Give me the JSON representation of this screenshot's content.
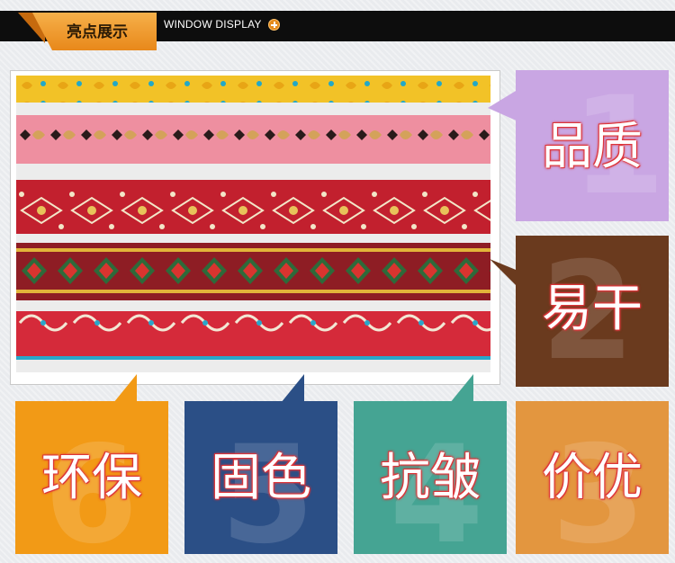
{
  "header": {
    "title_cn": "亮点展示",
    "title_en": "WINDOW DISPLAY"
  },
  "colors": {
    "header_bar": "#0d0d0d",
    "header_tag": "#f0a33a",
    "panel_quality": "#c9a6e3",
    "panel_quickdry": "#6a3a1e",
    "panel_eco": "#f29a16",
    "panel_colorfast": "#2b4f86",
    "panel_antiwrinkle": "#45a493",
    "panel_price": "#e3963f",
    "label_outline": "#e0383c"
  },
  "features": [
    {
      "id": "quality",
      "label": "品质",
      "number": "1"
    },
    {
      "id": "quick-dry",
      "label": "易干",
      "number": "2"
    },
    {
      "id": "price",
      "label": "价优",
      "number": "3"
    },
    {
      "id": "anti-wrinkle",
      "label": "抗皱",
      "number": "4"
    },
    {
      "id": "color-fast",
      "label": "固色",
      "number": "5"
    },
    {
      "id": "eco",
      "label": "环保",
      "number": "6"
    }
  ]
}
